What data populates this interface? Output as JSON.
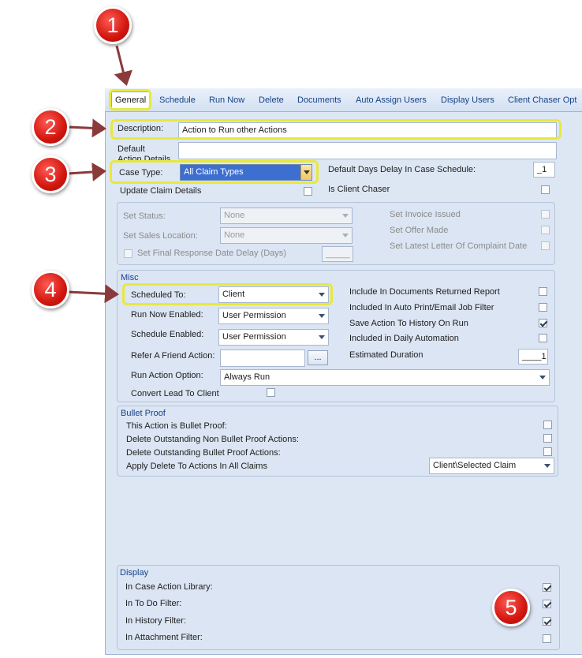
{
  "tabs": [
    "General",
    "Schedule",
    "Run Now",
    "Delete",
    "Documents",
    "Auto Assign Users",
    "Display Users",
    "Client Chaser Opt"
  ],
  "badges": [
    "1",
    "2",
    "3",
    "4",
    "5"
  ],
  "action_details": {
    "description_label": "Description:",
    "description_value": "Action to Run other Actions",
    "default_label": "Default",
    "action_details_label": "Action Details",
    "case_type_label": "Case Type:",
    "case_type_value": "All Claim Types",
    "default_days_delay_label": "Default Days Delay In Case Schedule:",
    "default_days_delay_value": "_1",
    "update_claim_details_label": "Update Claim Details",
    "update_claim_details_checked": false,
    "is_client_chaser_label": "Is Client Chaser",
    "is_client_chaser_checked": false
  },
  "status_group": {
    "set_status_label": "Set Status:",
    "set_status_value": "None",
    "set_sales_location_label": "Set Sales Location:",
    "set_sales_location_value": "None",
    "set_final_response_label": "Set Final Response Date Delay (Days)",
    "set_final_response_value": "_____",
    "set_invoice_issued_label": "Set Invoice Issued",
    "set_offer_made_label": "Set Offer Made",
    "set_latest_letter_label": "Set Latest Letter Of Complaint Date"
  },
  "misc": {
    "title": "Misc",
    "scheduled_to_label": "Scheduled To:",
    "scheduled_to_value": "Client",
    "run_now_enabled_label": "Run Now Enabled:",
    "run_now_enabled_value": "User Permission",
    "schedule_enabled_label": "Schedule Enabled:",
    "schedule_enabled_value": "User Permission",
    "refer_a_friend_label": "Refer A Friend Action:",
    "refer_a_friend_value": "",
    "refer_a_friend_button": "...",
    "run_action_option_label": "Run Action Option:",
    "run_action_option_value": "Always Run",
    "convert_lead_label": "Convert Lead To Client",
    "include_documents_label": "Include In Documents Returned Report",
    "included_auto_print_label": "Included In Auto Print/Email Job Filter",
    "save_action_history_label": "Save Action To History On Run",
    "included_daily_label": "Included in Daily Automation",
    "estimated_duration_label": "Estimated Duration",
    "estimated_duration_value": "____1",
    "save_action_history_checked": true
  },
  "bullet_proof": {
    "title": "Bullet Proof",
    "this_action_label": "This Action is Bullet Proof:",
    "delete_non_bullet_label": "Delete Outstanding Non Bullet Proof Actions:",
    "delete_bullet_label": "Delete Outstanding Bullet Proof Actions:",
    "apply_delete_label": "Apply Delete To Actions In All Claims",
    "apply_delete_value": "Client\\Selected Claim"
  },
  "display": {
    "title": "Display",
    "in_case_action_library_label": "In Case Action Library:",
    "in_to_do_filter_label": "In To Do Filter:",
    "in_history_filter_label": "In History Filter:",
    "in_attachment_filter_label": "In Attachment Filter:",
    "in_case_action_library_checked": true,
    "in_to_do_filter_checked": true,
    "in_history_filter_checked": true,
    "in_attachment_filter_checked": false
  },
  "colors": {
    "badge_red": "#d1160f",
    "highlight_yellow": "#e8e83c",
    "arrow": "#8b3a3a",
    "panel_bg": "#dde7f4",
    "tab_text": "#15428b"
  }
}
